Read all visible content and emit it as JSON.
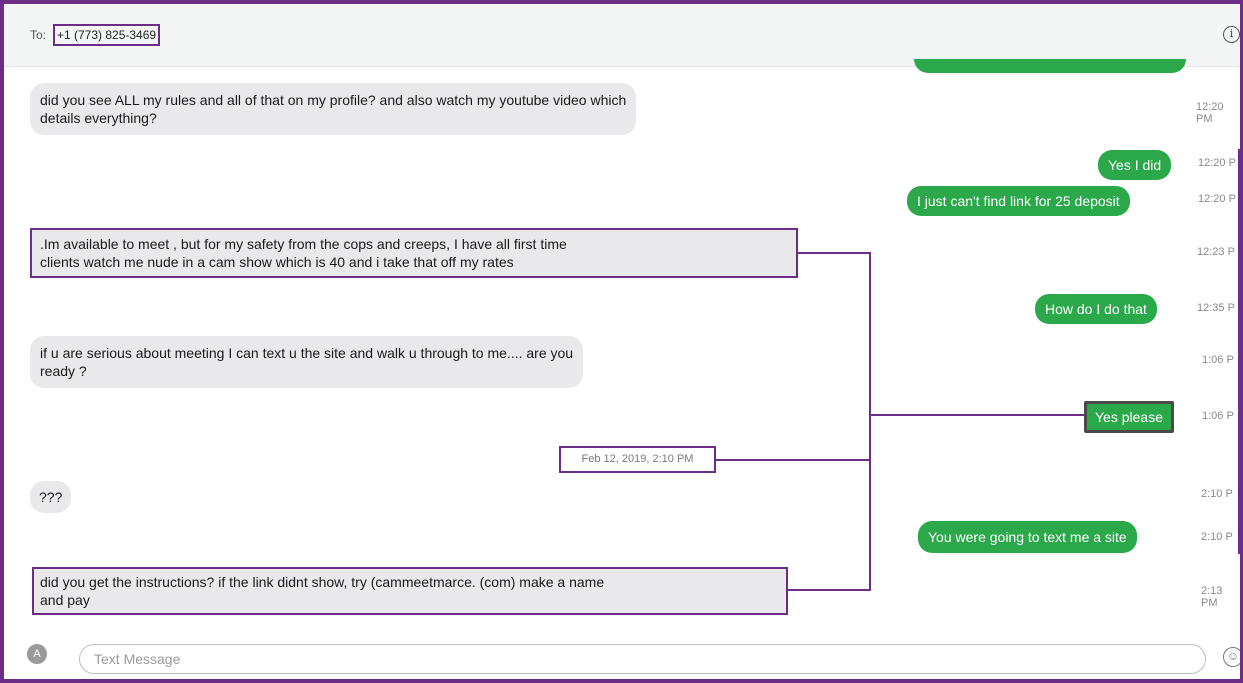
{
  "header": {
    "to_label": "To:",
    "recipient": "+1 (773) 825-3469",
    "info_icon": "info-icon"
  },
  "messages": [
    {
      "dir": "in",
      "text_lines": [
        "did you see ALL my  rules and all of that on my profile? and also watch my youtube   video which",
        "details   everything?"
      ],
      "time": "12:20 PM"
    },
    {
      "dir": "out",
      "text_lines": [
        "Yes I did"
      ],
      "time": "12:20 P"
    },
    {
      "dir": "out",
      "text_lines": [
        "I just can't find link for 25 deposit"
      ],
      "time": "12:20 P"
    },
    {
      "dir": "in",
      "text_lines": [
        ".Im  available    to  meet , but   for   my  safety from the cops and creeps, I   have all   first   time",
        "clients  watch    me  nude  in a cam    show    which   is 40 and  i take    that    off my    rates"
      ],
      "time": "12:23 P"
    },
    {
      "dir": "out",
      "text_lines": [
        "How do I do that"
      ],
      "time": "12:35 P"
    },
    {
      "dir": "in",
      "text_lines": [
        "if   u are    serious  about  meeting  I   can  text u the  site and   walk  u  through to me.... are  you",
        "ready   ?"
      ],
      "time": "1:06 P"
    },
    {
      "dir": "out",
      "text_lines": [
        "Yes please"
      ],
      "time": "1:06 P"
    },
    {
      "dir": "in",
      "text_lines": [
        "???"
      ],
      "time": "2:10 P"
    },
    {
      "dir": "out",
      "text_lines": [
        "You were going to text me a site"
      ],
      "time": "2:10 P"
    },
    {
      "dir": "in",
      "text_lines": [
        "did you get the  instructions? if the link   didnt show,    try (cammeetmarce. (com) make a    name",
        "and pay"
      ],
      "time": "2:13 PM"
    }
  ],
  "date_separator": "Feb 12, 2019, 2:10 PM",
  "composer": {
    "placeholder": "Text Message",
    "apps_icon": "app-store-icon",
    "emoji_icon": "emoji-icon"
  },
  "colors": {
    "outgoing_bubble": "#2aa84a",
    "incoming_bubble": "#e9e9eb",
    "annotation": "#6b2d86"
  }
}
